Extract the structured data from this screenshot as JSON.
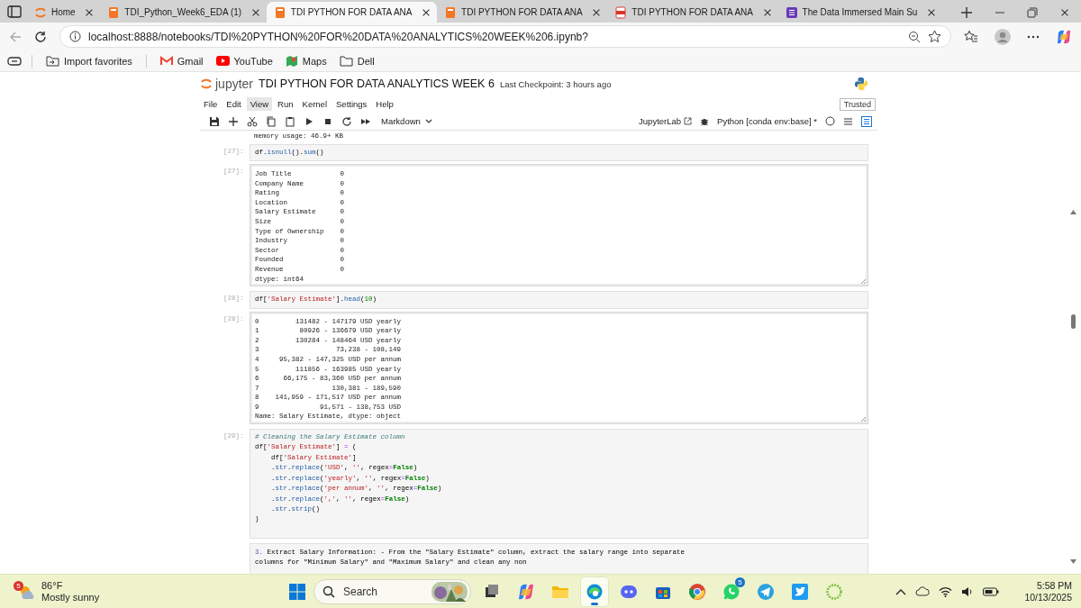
{
  "browser": {
    "tabs": [
      {
        "title": "Home",
        "selected": false
      },
      {
        "title": "TDI_Python_Week6_EDA (1)",
        "selected": false
      },
      {
        "title": "TDI PYTHON FOR DATA ANA",
        "selected": true
      },
      {
        "title": "TDI PYTHON FOR DATA ANA",
        "selected": false
      },
      {
        "title": "TDI PYTHON FOR DATA ANA",
        "selected": false
      },
      {
        "title": "The Data Immersed Main Su",
        "selected": false
      }
    ],
    "url": "localhost:8888/notebooks/TDI%20PYTHON%20FOR%20DATA%20ANALYTICS%20WEEK%206.ipynb?",
    "bookmarks": [
      "Import favorites",
      "Gmail",
      "YouTube",
      "Maps",
      "Dell"
    ]
  },
  "jupyter": {
    "logo_text": "jupyter",
    "title": "TDI PYTHON FOR DATA ANALYTICS WEEK 6",
    "checkpoint": "Last Checkpoint: 3 hours ago",
    "menu": [
      {
        "label": "File",
        "selected": false
      },
      {
        "label": "Edit",
        "selected": false
      },
      {
        "label": "View",
        "selected": true
      },
      {
        "label": "Run",
        "selected": false
      },
      {
        "label": "Kernel",
        "selected": false
      },
      {
        "label": "Settings",
        "selected": false
      },
      {
        "label": "Help",
        "selected": false
      }
    ],
    "trusted": "Trusted",
    "cell_type": "Markdown",
    "jupyterlab": "JupyterLab",
    "kernel": "Python [conda env:base] *"
  },
  "cells": [
    {
      "kind": "stream",
      "lines": [
        "memory usage: 46.9+ KB"
      ]
    },
    {
      "kind": "code",
      "prompt": "[27]:",
      "code": [
        [
          {
            "text": "df.",
            "kind": "plain"
          },
          {
            "text": "isnull",
            "kind": "function"
          },
          {
            "text": "().",
            "kind": "plain"
          },
          {
            "text": "sum",
            "kind": "function"
          },
          {
            "text": "()",
            "kind": "plain"
          }
        ]
      ]
    },
    {
      "kind": "output",
      "prompt": "[27]:",
      "lines": [
        "Job Title            0",
        "Company Name         0",
        "Rating               0",
        "Location             0",
        "Salary Estimate      0",
        "Size                 0",
        "Type of Ownership    0",
        "Industry             0",
        "Sector               0",
        "Founded              0",
        "Revenue              0",
        "dtype: int64"
      ]
    },
    {
      "kind": "code",
      "prompt": "[28]:",
      "code": [
        [
          {
            "text": "df[",
            "kind": "plain"
          },
          {
            "text": "'Salary Estimate'",
            "kind": "string"
          },
          {
            "text": "].",
            "kind": "plain"
          },
          {
            "text": "head",
            "kind": "function"
          },
          {
            "text": "(",
            "kind": "plain"
          },
          {
            "text": "10",
            "kind": "number"
          },
          {
            "text": ")",
            "kind": "plain"
          }
        ]
      ]
    },
    {
      "kind": "output",
      "prompt": "[28]:",
      "lines": [
        "0         131482 - 147179 USD yearly",
        "1          80926 - 136679 USD yearly",
        "2         130284 - 148464 USD yearly",
        "3                   73,238 - 108,149",
        "4     95,382 - 147,325 USD per annum",
        "5         111856 - 163985 USD yearly",
        "6      66,175 - 83,360 USD per annum",
        "7                  130,381 - 189,590",
        "8    141,959 - 171,517 USD per annum",
        "9               91,571 - 138,753 USD",
        "Name: Salary Estimate, dtype: object"
      ]
    },
    {
      "kind": "code",
      "prompt": "[29]:",
      "code": [
        [
          {
            "text": "# Cleaning the Salary Estimate column",
            "kind": "comment"
          }
        ],
        [
          {
            "text": "df[",
            "kind": "plain"
          },
          {
            "text": "'Salary Estimate'",
            "kind": "string"
          },
          {
            "text": "] ",
            "kind": "plain"
          },
          {
            "text": "=",
            "kind": "operator"
          },
          {
            "text": " (",
            "kind": "plain"
          }
        ],
        [
          {
            "text": "    df[",
            "kind": "plain"
          },
          {
            "text": "'Salary Estimate'",
            "kind": "string"
          },
          {
            "text": "]",
            "kind": "plain"
          }
        ],
        [
          {
            "text": "    .",
            "kind": "plain"
          },
          {
            "text": "str",
            "kind": "function"
          },
          {
            "text": ".",
            "kind": "plain"
          },
          {
            "text": "replace",
            "kind": "function"
          },
          {
            "text": "(",
            "kind": "plain"
          },
          {
            "text": "'USD'",
            "kind": "string"
          },
          {
            "text": ", ",
            "kind": "plain"
          },
          {
            "text": "''",
            "kind": "string"
          },
          {
            "text": ", regex",
            "kind": "plain"
          },
          {
            "text": "=",
            "kind": "operator"
          },
          {
            "text": "False",
            "kind": "keyword"
          },
          {
            "text": ")",
            "kind": "plain"
          }
        ],
        [
          {
            "text": "    .",
            "kind": "plain"
          },
          {
            "text": "str",
            "kind": "function"
          },
          {
            "text": ".",
            "kind": "plain"
          },
          {
            "text": "replace",
            "kind": "function"
          },
          {
            "text": "(",
            "kind": "plain"
          },
          {
            "text": "'yearly'",
            "kind": "string"
          },
          {
            "text": ", ",
            "kind": "plain"
          },
          {
            "text": "''",
            "kind": "string"
          },
          {
            "text": ", regex",
            "kind": "plain"
          },
          {
            "text": "=",
            "kind": "operator"
          },
          {
            "text": "False",
            "kind": "keyword"
          },
          {
            "text": ")",
            "kind": "plain"
          }
        ],
        [
          {
            "text": "    .",
            "kind": "plain"
          },
          {
            "text": "str",
            "kind": "function"
          },
          {
            "text": ".",
            "kind": "plain"
          },
          {
            "text": "replace",
            "kind": "function"
          },
          {
            "text": "(",
            "kind": "plain"
          },
          {
            "text": "'per annum'",
            "kind": "string"
          },
          {
            "text": ", ",
            "kind": "plain"
          },
          {
            "text": "''",
            "kind": "string"
          },
          {
            "text": ", regex",
            "kind": "plain"
          },
          {
            "text": "=",
            "kind": "operator"
          },
          {
            "text": "False",
            "kind": "keyword"
          },
          {
            "text": ")",
            "kind": "plain"
          }
        ],
        [
          {
            "text": "    .",
            "kind": "plain"
          },
          {
            "text": "str",
            "kind": "function"
          },
          {
            "text": ".",
            "kind": "plain"
          },
          {
            "text": "replace",
            "kind": "function"
          },
          {
            "text": "(",
            "kind": "plain"
          },
          {
            "text": "','",
            "kind": "string"
          },
          {
            "text": ", ",
            "kind": "plain"
          },
          {
            "text": "''",
            "kind": "string"
          },
          {
            "text": ", regex",
            "kind": "plain"
          },
          {
            "text": "=",
            "kind": "operator"
          },
          {
            "text": "False",
            "kind": "keyword"
          },
          {
            "text": ")",
            "kind": "plain"
          }
        ],
        [
          {
            "text": "    .",
            "kind": "plain"
          },
          {
            "text": "str",
            "kind": "function"
          },
          {
            "text": ".",
            "kind": "plain"
          },
          {
            "text": "strip",
            "kind": "function"
          },
          {
            "text": "()",
            "kind": "plain"
          }
        ],
        [
          {
            "text": ")",
            "kind": "plain"
          }
        ]
      ]
    },
    {
      "kind": "markdown",
      "code": [
        [
          {
            "text": "3.",
            "kind": "listnum"
          },
          {
            "text": " Extract Salary Information: - From the \"Salary Estimate\" column, extract the salary range into separate",
            "kind": "plain"
          }
        ],
        [
          {
            "text": "columns for \"Minimum Salary\" and \"Maximum Salary\" and clean any non",
            "kind": "plain"
          }
        ]
      ]
    }
  ],
  "taskbar": {
    "weather": {
      "badge": "5",
      "temp": "86°F",
      "desc": "Mostly sunny"
    },
    "search": {
      "placeholder": "Search"
    },
    "apps": [
      {
        "selected": false
      },
      {
        "selected": false
      },
      {
        "selected": false
      },
      {
        "selected": true
      },
      {
        "selected": false
      },
      {
        "selected": false
      },
      {
        "selected": false
      },
      {
        "selected": false,
        "badge": "5"
      },
      {
        "selected": false
      },
      {
        "selected": false
      },
      {
        "selected": false
      }
    ],
    "time": "5:58 PM",
    "date": "10/13/2025"
  }
}
